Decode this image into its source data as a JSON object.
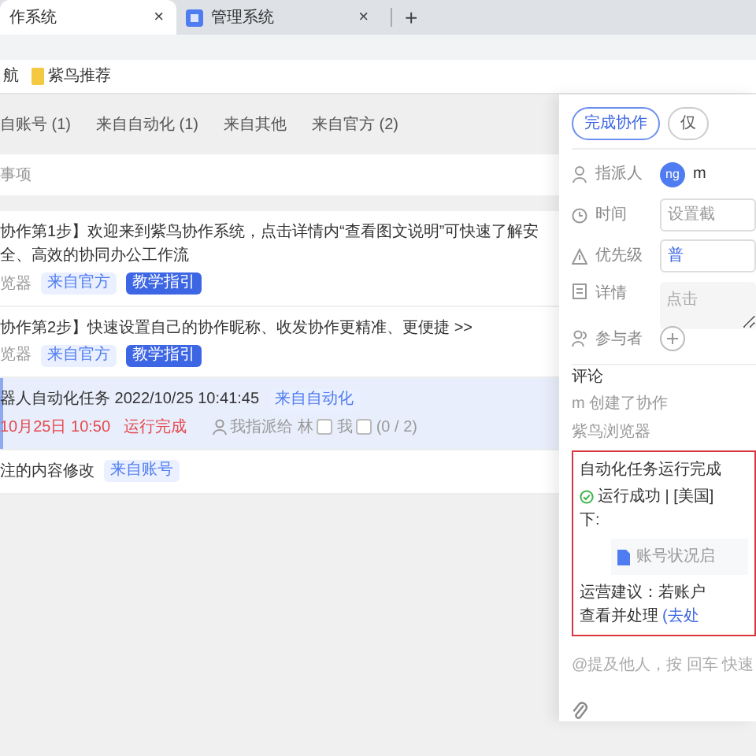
{
  "browser_tabs": [
    {
      "title": "作系统",
      "close": "×",
      "selected": true
    },
    {
      "title": "管理系统",
      "close": "×",
      "selected": false
    }
  ],
  "new_tab": "+",
  "bookmarks": [
    {
      "label": "航",
      "kind": "text"
    },
    {
      "label": "紫鸟推荐",
      "kind": "folder"
    }
  ],
  "filter_tabs": [
    {
      "label": "自账号 (1)"
    },
    {
      "label": "来自自动化 (1)"
    },
    {
      "label": "来自其他"
    },
    {
      "label": "来自官方 (2)"
    }
  ],
  "section_label": "事项",
  "tasks": [
    {
      "kind": "guide",
      "title": "协作第1步】欢迎来到紫鸟协作系统，点击详情内“查看图文说明”可快速了解安全、高效的协同办公工作流",
      "source": "览器",
      "tags": [
        {
          "label": "来自官方",
          "kind": "light"
        },
        {
          "label": "教学指引",
          "kind": "solid"
        }
      ],
      "selected": false
    },
    {
      "kind": "guide",
      "title": "协作第2步】快速设置自己的协作昵称、收发协作更精准、更便捷 >>",
      "source": "览器",
      "tags": [
        {
          "label": "来自官方",
          "kind": "light"
        },
        {
          "label": "教学指引",
          "kind": "solid"
        }
      ],
      "selected": false
    },
    {
      "kind": "automation",
      "title": "器人自动化任务 2022/10/25 10:41:45",
      "tags": [
        {
          "label": "来自自动化",
          "kind": "light"
        }
      ],
      "due": "10月25日 10:50",
      "status": "运行完成",
      "assignee": "我指派给 林",
      "me": "我",
      "assignee_checked": false,
      "me_checked": false,
      "progress": "(0 / 2)",
      "selected": true
    },
    {
      "kind": "simple",
      "title": "注的内容修改",
      "tags": [
        {
          "label": "来自账号",
          "kind": "light"
        }
      ],
      "selected": false
    }
  ],
  "drawer": {
    "actions": [
      {
        "label": "完成协作",
        "kind": "primary"
      },
      {
        "label": "仅",
        "kind": "outline"
      }
    ],
    "fields": [
      {
        "label": "指派人",
        "kind": "assignee",
        "avatar": "ng",
        "value": "m"
      },
      {
        "label": "时间",
        "kind": "input",
        "placeholder": "设置截"
      },
      {
        "label": "优先级",
        "kind": "select",
        "value": "普"
      },
      {
        "label": "详情",
        "kind": "textarea",
        "placeholder": "点击"
      },
      {
        "label": "参与者",
        "kind": "add"
      }
    ],
    "comments_title": "评论",
    "log_actor": "m",
    "log_action": "创建了协作",
    "log_source": "紫鸟浏览器",
    "message": {
      "title": "自动化任务运行完成",
      "status": "运行成功 | [美国]",
      "status_tail": "下:",
      "attachment": "账号状况启",
      "advice": "运营建议：若账户",
      "advice_action": "查看并处理",
      "link": "(去处"
    },
    "comment_placeholder": "@提及他人，按 回车 快速"
  }
}
